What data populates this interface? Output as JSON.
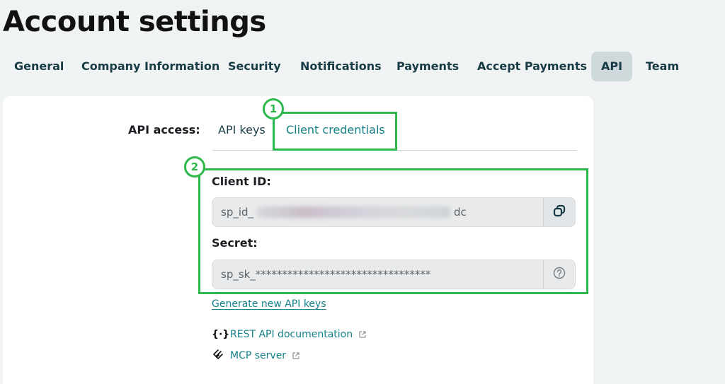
{
  "page": {
    "title": "Account settings"
  },
  "tabs": [
    {
      "label": "General"
    },
    {
      "label": "Company Information"
    },
    {
      "label": "Security"
    },
    {
      "label": "Notifications"
    },
    {
      "label": "Payments"
    },
    {
      "label": "Accept Payments"
    },
    {
      "label": "API",
      "active": true
    },
    {
      "label": "Team"
    }
  ],
  "api": {
    "access_label": "API access:",
    "subtabs": [
      {
        "label": "API keys"
      },
      {
        "label": "Client credentials",
        "active": true
      }
    ],
    "client_id": {
      "label": "Client ID:",
      "value_prefix": "sp_id_",
      "value_suffix": "dc",
      "masked": true
    },
    "secret": {
      "label": "Secret:",
      "value": "sp_sk_*********************************"
    },
    "generate_link": "Generate new API keys",
    "resources": [
      {
        "icon": "code-braces-icon",
        "glyph": "{·}",
        "label": "REST API documentation"
      },
      {
        "icon": "mcp-server-icon",
        "label": "MCP server"
      }
    ]
  },
  "annotations": [
    {
      "label": "1"
    },
    {
      "label": "2"
    }
  ],
  "colors": {
    "accent": "#15818a",
    "highlight": "#2db84b",
    "background": "#f0f3f4",
    "active_tab": "#cfd9dc"
  }
}
